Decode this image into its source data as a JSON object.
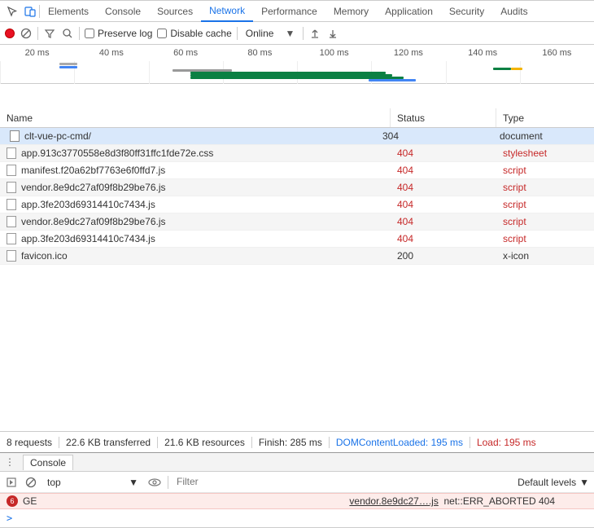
{
  "top_tabs": [
    "Elements",
    "Console",
    "Sources",
    "Network",
    "Performance",
    "Memory",
    "Application",
    "Security",
    "Audits"
  ],
  "active_tab": "Network",
  "toolbar": {
    "preserve_log": "Preserve log",
    "disable_cache": "Disable cache",
    "throttling": "Online"
  },
  "timeline_ticks": [
    "20 ms",
    "40 ms",
    "60 ms",
    "80 ms",
    "100 ms",
    "120 ms",
    "140 ms",
    "160 ms"
  ],
  "columns": {
    "name": "Name",
    "status": "Status",
    "type": "Type"
  },
  "rows": [
    {
      "name": "clt-vue-pc-cmd/",
      "status": "304",
      "type": "document",
      "err": false,
      "sel": true,
      "icon": "folder"
    },
    {
      "name": "app.913c3770558e8d3f80ff31ffc1fde72e.css",
      "status": "404",
      "type": "stylesheet",
      "err": true,
      "sel": false,
      "icon": "file"
    },
    {
      "name": "manifest.f20a62bf7763e6f0ffd7.js",
      "status": "404",
      "type": "script",
      "err": true,
      "sel": false,
      "icon": "file"
    },
    {
      "name": "vendor.8e9dc27af09f8b29be76.js",
      "status": "404",
      "type": "script",
      "err": true,
      "sel": false,
      "icon": "file"
    },
    {
      "name": "app.3fe203d69314410c7434.js",
      "status": "404",
      "type": "script",
      "err": true,
      "sel": false,
      "icon": "file"
    },
    {
      "name": "vendor.8e9dc27af09f8b29be76.js",
      "status": "404",
      "type": "script",
      "err": true,
      "sel": false,
      "icon": "file"
    },
    {
      "name": "app.3fe203d69314410c7434.js",
      "status": "404",
      "type": "script",
      "err": true,
      "sel": false,
      "icon": "file"
    },
    {
      "name": "favicon.ico",
      "status": "200",
      "type": "x-icon",
      "err": false,
      "sel": false,
      "icon": "file"
    }
  ],
  "summary": {
    "requests": "8 requests",
    "transferred": "22.6 KB transferred",
    "resources": "21.6 KB resources",
    "finish": "Finish: 285 ms",
    "dom": "DOMContentLoaded: 195 ms",
    "load": "Load: 195 ms"
  },
  "drawer_tab": "Console",
  "console": {
    "context": "top",
    "filter_placeholder": "Filter",
    "levels": "Default levels",
    "err_count": "6",
    "err_method": "GE",
    "err_src": "vendor.8e9dc27….js",
    "err_msg": "net::ERR_ABORTED 404",
    "prompt": ">"
  }
}
